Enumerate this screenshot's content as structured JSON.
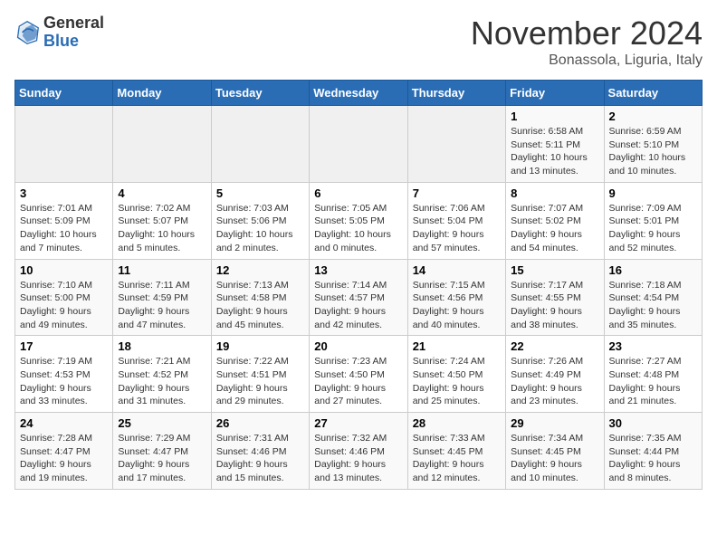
{
  "header": {
    "logo_general": "General",
    "logo_blue": "Blue",
    "month_title": "November 2024",
    "location": "Bonassola, Liguria, Italy"
  },
  "weekdays": [
    "Sunday",
    "Monday",
    "Tuesday",
    "Wednesday",
    "Thursday",
    "Friday",
    "Saturday"
  ],
  "weeks": [
    [
      {
        "day": "",
        "info": ""
      },
      {
        "day": "",
        "info": ""
      },
      {
        "day": "",
        "info": ""
      },
      {
        "day": "",
        "info": ""
      },
      {
        "day": "",
        "info": ""
      },
      {
        "day": "1",
        "info": "Sunrise: 6:58 AM\nSunset: 5:11 PM\nDaylight: 10 hours and 13 minutes."
      },
      {
        "day": "2",
        "info": "Sunrise: 6:59 AM\nSunset: 5:10 PM\nDaylight: 10 hours and 10 minutes."
      }
    ],
    [
      {
        "day": "3",
        "info": "Sunrise: 7:01 AM\nSunset: 5:09 PM\nDaylight: 10 hours and 7 minutes."
      },
      {
        "day": "4",
        "info": "Sunrise: 7:02 AM\nSunset: 5:07 PM\nDaylight: 10 hours and 5 minutes."
      },
      {
        "day": "5",
        "info": "Sunrise: 7:03 AM\nSunset: 5:06 PM\nDaylight: 10 hours and 2 minutes."
      },
      {
        "day": "6",
        "info": "Sunrise: 7:05 AM\nSunset: 5:05 PM\nDaylight: 10 hours and 0 minutes."
      },
      {
        "day": "7",
        "info": "Sunrise: 7:06 AM\nSunset: 5:04 PM\nDaylight: 9 hours and 57 minutes."
      },
      {
        "day": "8",
        "info": "Sunrise: 7:07 AM\nSunset: 5:02 PM\nDaylight: 9 hours and 54 minutes."
      },
      {
        "day": "9",
        "info": "Sunrise: 7:09 AM\nSunset: 5:01 PM\nDaylight: 9 hours and 52 minutes."
      }
    ],
    [
      {
        "day": "10",
        "info": "Sunrise: 7:10 AM\nSunset: 5:00 PM\nDaylight: 9 hours and 49 minutes."
      },
      {
        "day": "11",
        "info": "Sunrise: 7:11 AM\nSunset: 4:59 PM\nDaylight: 9 hours and 47 minutes."
      },
      {
        "day": "12",
        "info": "Sunrise: 7:13 AM\nSunset: 4:58 PM\nDaylight: 9 hours and 45 minutes."
      },
      {
        "day": "13",
        "info": "Sunrise: 7:14 AM\nSunset: 4:57 PM\nDaylight: 9 hours and 42 minutes."
      },
      {
        "day": "14",
        "info": "Sunrise: 7:15 AM\nSunset: 4:56 PM\nDaylight: 9 hours and 40 minutes."
      },
      {
        "day": "15",
        "info": "Sunrise: 7:17 AM\nSunset: 4:55 PM\nDaylight: 9 hours and 38 minutes."
      },
      {
        "day": "16",
        "info": "Sunrise: 7:18 AM\nSunset: 4:54 PM\nDaylight: 9 hours and 35 minutes."
      }
    ],
    [
      {
        "day": "17",
        "info": "Sunrise: 7:19 AM\nSunset: 4:53 PM\nDaylight: 9 hours and 33 minutes."
      },
      {
        "day": "18",
        "info": "Sunrise: 7:21 AM\nSunset: 4:52 PM\nDaylight: 9 hours and 31 minutes."
      },
      {
        "day": "19",
        "info": "Sunrise: 7:22 AM\nSunset: 4:51 PM\nDaylight: 9 hours and 29 minutes."
      },
      {
        "day": "20",
        "info": "Sunrise: 7:23 AM\nSunset: 4:50 PM\nDaylight: 9 hours and 27 minutes."
      },
      {
        "day": "21",
        "info": "Sunrise: 7:24 AM\nSunset: 4:50 PM\nDaylight: 9 hours and 25 minutes."
      },
      {
        "day": "22",
        "info": "Sunrise: 7:26 AM\nSunset: 4:49 PM\nDaylight: 9 hours and 23 minutes."
      },
      {
        "day": "23",
        "info": "Sunrise: 7:27 AM\nSunset: 4:48 PM\nDaylight: 9 hours and 21 minutes."
      }
    ],
    [
      {
        "day": "24",
        "info": "Sunrise: 7:28 AM\nSunset: 4:47 PM\nDaylight: 9 hours and 19 minutes."
      },
      {
        "day": "25",
        "info": "Sunrise: 7:29 AM\nSunset: 4:47 PM\nDaylight: 9 hours and 17 minutes."
      },
      {
        "day": "26",
        "info": "Sunrise: 7:31 AM\nSunset: 4:46 PM\nDaylight: 9 hours and 15 minutes."
      },
      {
        "day": "27",
        "info": "Sunrise: 7:32 AM\nSunset: 4:46 PM\nDaylight: 9 hours and 13 minutes."
      },
      {
        "day": "28",
        "info": "Sunrise: 7:33 AM\nSunset: 4:45 PM\nDaylight: 9 hours and 12 minutes."
      },
      {
        "day": "29",
        "info": "Sunrise: 7:34 AM\nSunset: 4:45 PM\nDaylight: 9 hours and 10 minutes."
      },
      {
        "day": "30",
        "info": "Sunrise: 7:35 AM\nSunset: 4:44 PM\nDaylight: 9 hours and 8 minutes."
      }
    ]
  ]
}
